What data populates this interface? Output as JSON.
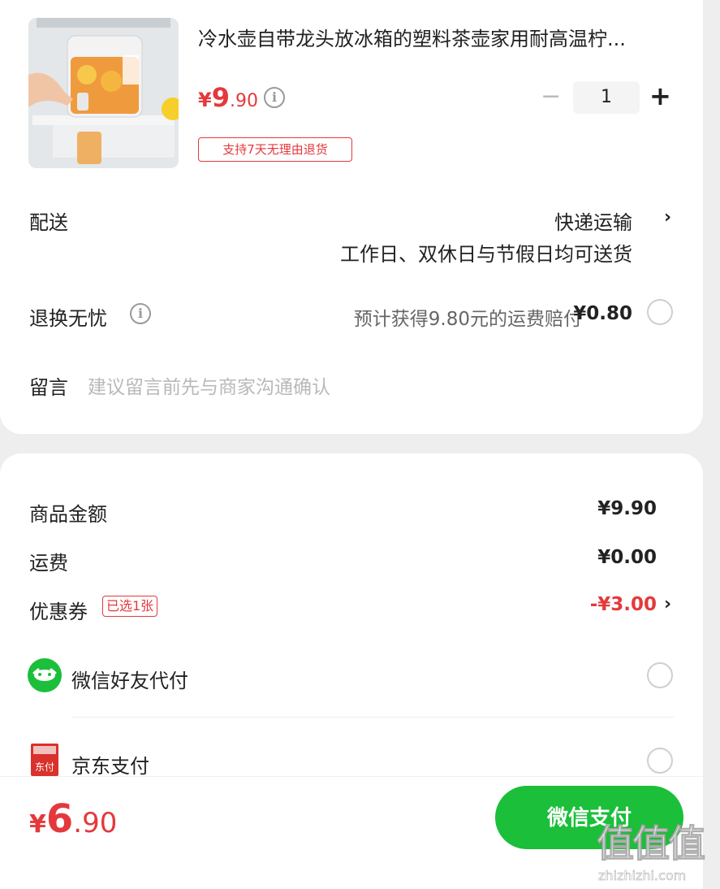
{
  "product": {
    "title": "冷水壶自带龙头放冰箱的塑料茶壶家用耐高温柠...",
    "price_symbol": "¥",
    "price_int": "9",
    "price_dec": ".90",
    "quantity": "1",
    "return_badge": "支持7天无理由退货"
  },
  "delivery": {
    "label": "配送",
    "method": "快递运输",
    "note": "工作日、双休日与节假日均可送货"
  },
  "return_worry": {
    "label": "退换无忧",
    "desc": "预计获得9.80元的运费赔付",
    "price": "¥0.80"
  },
  "message": {
    "label": "留言",
    "placeholder": "建议留言前先与商家沟通确认"
  },
  "summary": {
    "goods_label": "商品金额",
    "goods_value": "¥9.90",
    "shipping_label": "运费",
    "shipping_value": "¥0.00",
    "coupon_label": "优惠券",
    "coupon_tag": "已选1张",
    "coupon_value": "-¥3.00"
  },
  "payment": {
    "wechat_friend": "微信好友代付",
    "jd_pay": "京东支付",
    "jd_icon_text": "东付"
  },
  "footer": {
    "total_symbol": "¥",
    "total_int": "6",
    "total_dec": ".90",
    "pay_button": "微信支付"
  },
  "watermark": {
    "logo": "值值值",
    "url": "zhizhizhi.com"
  },
  "colors": {
    "accent_red": "#e4393c",
    "wechat_green": "#1bbf3a",
    "jd_red": "#d9312b"
  }
}
